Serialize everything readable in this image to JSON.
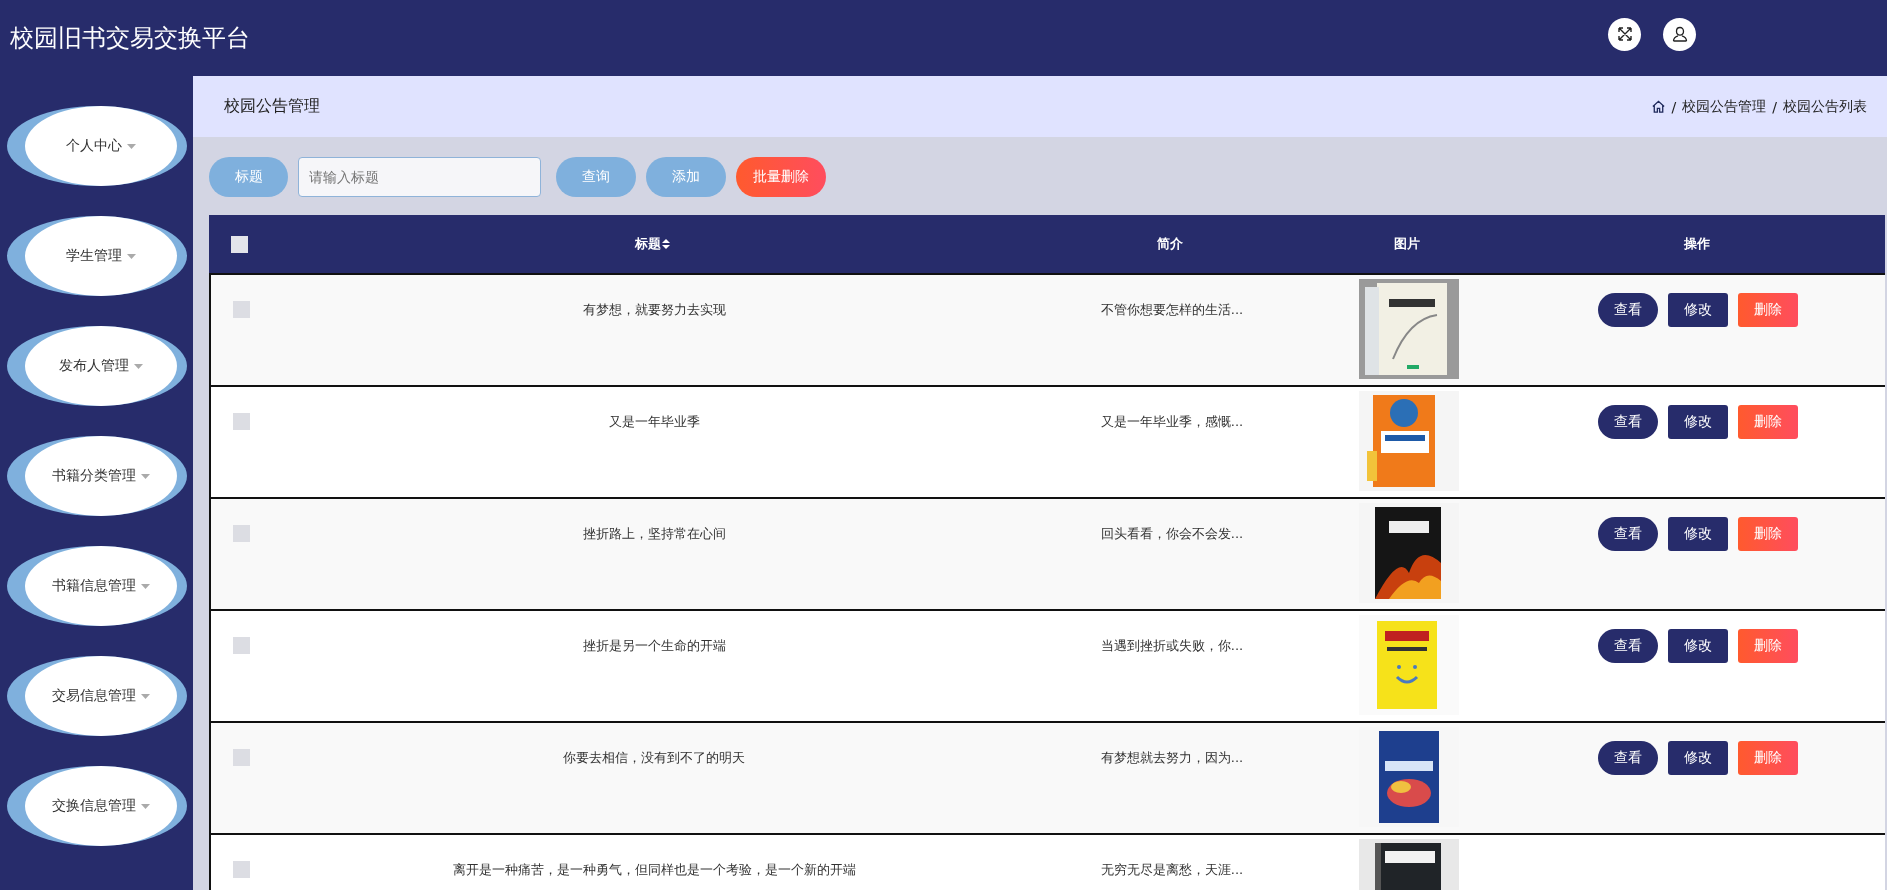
{
  "header": {
    "title": "校园旧书交易交换平台"
  },
  "sidebar": {
    "items": [
      {
        "label": "个人中心"
      },
      {
        "label": "学生管理"
      },
      {
        "label": "发布人管理"
      },
      {
        "label": "书籍分类管理"
      },
      {
        "label": "书籍信息管理"
      },
      {
        "label": "交易信息管理"
      },
      {
        "label": "交换信息管理"
      }
    ]
  },
  "page_header": {
    "title": "校园公告管理",
    "breadcrumb": {
      "separator": "/",
      "items": [
        "校园公告管理",
        "校园公告列表"
      ]
    }
  },
  "toolbar": {
    "label": "标题",
    "search": {
      "placeholder": "请输入标题"
    },
    "buttons": [
      {
        "label": "查询",
        "kind": "primary"
      },
      {
        "label": "添加",
        "kind": "primary"
      },
      {
        "label": "批量删除",
        "kind": "danger"
      }
    ]
  },
  "table": {
    "select_all": {
      "checked": false
    },
    "columns": [
      {
        "label": "标题",
        "sortable": true
      },
      {
        "label": "简介",
        "sortable": false
      },
      {
        "label": "图片",
        "sortable": false
      },
      {
        "label": "操作",
        "sortable": false
      }
    ],
    "rows": [
      {
        "checked": false,
        "title": "有梦想，就要努力去实现",
        "intro": "不管你想要怎样的生活...",
        "image": {
          "kind": "picture"
        },
        "actions": [
          {
            "label": "查看",
            "kind": "view"
          },
          {
            "label": "修改",
            "kind": "edit"
          },
          {
            "label": "删除",
            "kind": "delete"
          }
        ]
      },
      {
        "checked": false,
        "title": "又是一年毕业季",
        "intro": "又是一年毕业季，感慨...",
        "image": {
          "kind": "picture"
        },
        "actions": [
          {
            "label": "查看",
            "kind": "view"
          },
          {
            "label": "修改",
            "kind": "edit"
          },
          {
            "label": "删除",
            "kind": "delete"
          }
        ]
      },
      {
        "checked": false,
        "title": "挫折路上，坚持常在心间",
        "intro": "回头看看，你会不会发...",
        "image": {
          "kind": "picture"
        },
        "actions": [
          {
            "label": "查看",
            "kind": "view"
          },
          {
            "label": "修改",
            "kind": "edit"
          },
          {
            "label": "删除",
            "kind": "delete"
          }
        ]
      },
      {
        "checked": false,
        "title": "挫折是另一个生命的开端",
        "intro": "当遇到挫折或失败，你...",
        "image": {
          "kind": "picture"
        },
        "actions": [
          {
            "label": "查看",
            "kind": "view"
          },
          {
            "label": "修改",
            "kind": "edit"
          },
          {
            "label": "删除",
            "kind": "delete"
          }
        ]
      },
      {
        "checked": false,
        "title": "你要去相信，没有到不了的明天",
        "intro": "有梦想就去努力，因为...",
        "image": {
          "kind": "picture"
        },
        "actions": [
          {
            "label": "查看",
            "kind": "view"
          },
          {
            "label": "修改",
            "kind": "edit"
          },
          {
            "label": "删除",
            "kind": "delete"
          }
        ]
      },
      {
        "checked": false,
        "title": "离开是一种痛苦，是一种勇气，但同样也是一个考验，是一个新的开端",
        "intro": "无穷无尽是离愁，天涯...",
        "image": {
          "kind": "picture"
        }
      }
    ]
  }
}
